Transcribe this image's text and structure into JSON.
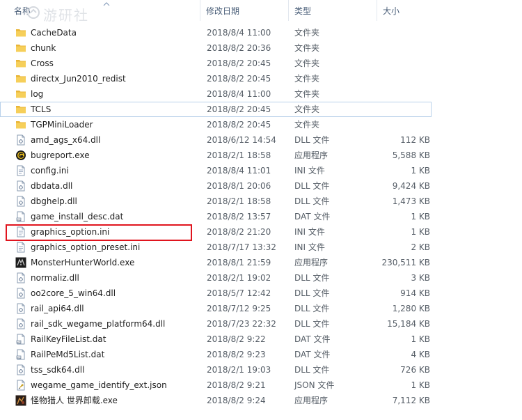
{
  "columns": {
    "name": "名称",
    "date": "修改日期",
    "type": "类型",
    "size": "大小"
  },
  "watermark": "游研社",
  "files": [
    {
      "name": "CacheData",
      "date": "2018/8/4 11:00",
      "type": "文件夹",
      "size": "",
      "icon": "folder-icon"
    },
    {
      "name": "chunk",
      "date": "2018/8/2 20:36",
      "type": "文件夹",
      "size": "",
      "icon": "folder-icon"
    },
    {
      "name": "Cross",
      "date": "2018/8/2 20:45",
      "type": "文件夹",
      "size": "",
      "icon": "folder-icon"
    },
    {
      "name": "directx_Jun2010_redist",
      "date": "2018/8/2 20:45",
      "type": "文件夹",
      "size": "",
      "icon": "folder-icon"
    },
    {
      "name": "log",
      "date": "2018/8/4 11:00",
      "type": "文件夹",
      "size": "",
      "icon": "folder-icon"
    },
    {
      "name": "TCLS",
      "date": "2018/8/2 20:45",
      "type": "文件夹",
      "size": "",
      "icon": "folder-icon"
    },
    {
      "name": "TGPMiniLoader",
      "date": "2018/8/2 20:45",
      "type": "文件夹",
      "size": "",
      "icon": "folder-icon"
    },
    {
      "name": "amd_ags_x64.dll",
      "date": "2018/6/12 14:54",
      "type": "DLL 文件",
      "size": "112 KB",
      "icon": "dll-file-icon"
    },
    {
      "name": "bugreport.exe",
      "date": "2018/2/1 18:58",
      "type": "应用程序",
      "size": "5,588 KB",
      "icon": "bugreport-app-icon"
    },
    {
      "name": "config.ini",
      "date": "2018/8/4 11:01",
      "type": "INI 文件",
      "size": "1 KB",
      "icon": "ini-file-icon"
    },
    {
      "name": "dbdata.dll",
      "date": "2018/8/1 20:06",
      "type": "DLL 文件",
      "size": "9,424 KB",
      "icon": "dll-file-icon"
    },
    {
      "name": "dbghelp.dll",
      "date": "2018/2/1 18:58",
      "type": "DLL 文件",
      "size": "1,473 KB",
      "icon": "dll-file-icon"
    },
    {
      "name": "game_install_desc.dat",
      "date": "2018/8/2 13:57",
      "type": "DAT 文件",
      "size": "1 KB",
      "icon": "dat-file-icon"
    },
    {
      "name": "graphics_option.ini",
      "date": "2018/8/2 21:20",
      "type": "INI 文件",
      "size": "1 KB",
      "icon": "ini-file-icon"
    },
    {
      "name": "graphics_option_preset.ini",
      "date": "2018/7/17 13:32",
      "type": "INI 文件",
      "size": "2 KB",
      "icon": "ini-file-icon"
    },
    {
      "name": "MonsterHunterWorld.exe",
      "date": "2018/8/1 21:59",
      "type": "应用程序",
      "size": "230,511 KB",
      "icon": "monster-hunter-app-icon"
    },
    {
      "name": "normaliz.dll",
      "date": "2018/2/1 19:02",
      "type": "DLL 文件",
      "size": "3 KB",
      "icon": "dll-file-icon"
    },
    {
      "name": "oo2core_5_win64.dll",
      "date": "2018/5/7 12:42",
      "type": "DLL 文件",
      "size": "914 KB",
      "icon": "dll-file-icon"
    },
    {
      "name": "rail_api64.dll",
      "date": "2018/7/12 9:25",
      "type": "DLL 文件",
      "size": "1,280 KB",
      "icon": "dll-file-icon"
    },
    {
      "name": "rail_sdk_wegame_platform64.dll",
      "date": "2018/7/23 22:32",
      "type": "DLL 文件",
      "size": "15,184 KB",
      "icon": "dll-file-icon"
    },
    {
      "name": "RailKeyFileList.dat",
      "date": "2018/8/2 9:22",
      "type": "DAT 文件",
      "size": "1 KB",
      "icon": "dat-file-icon"
    },
    {
      "name": "RailPeMd5List.dat",
      "date": "2018/8/2 9:23",
      "type": "DAT 文件",
      "size": "4 KB",
      "icon": "dat-file-icon"
    },
    {
      "name": "tss_sdk64.dll",
      "date": "2018/2/1 19:03",
      "type": "DLL 文件",
      "size": "726 KB",
      "icon": "dll-file-icon"
    },
    {
      "name": "wegame_game_identify_ext.json",
      "date": "2018/8/2 9:21",
      "type": "JSON 文件",
      "size": "1 KB",
      "icon": "json-file-icon"
    },
    {
      "name": "怪物猎人 世界卸载.exe",
      "date": "2018/8/2 9:24",
      "type": "应用程序",
      "size": "7,112 KB",
      "icon": "uninstaller-app-icon"
    }
  ],
  "colors": {
    "highlight": "#e0141e",
    "hover_border": "#b9d1ea",
    "header_text": "#4c607a",
    "folder": "#f3c244"
  }
}
